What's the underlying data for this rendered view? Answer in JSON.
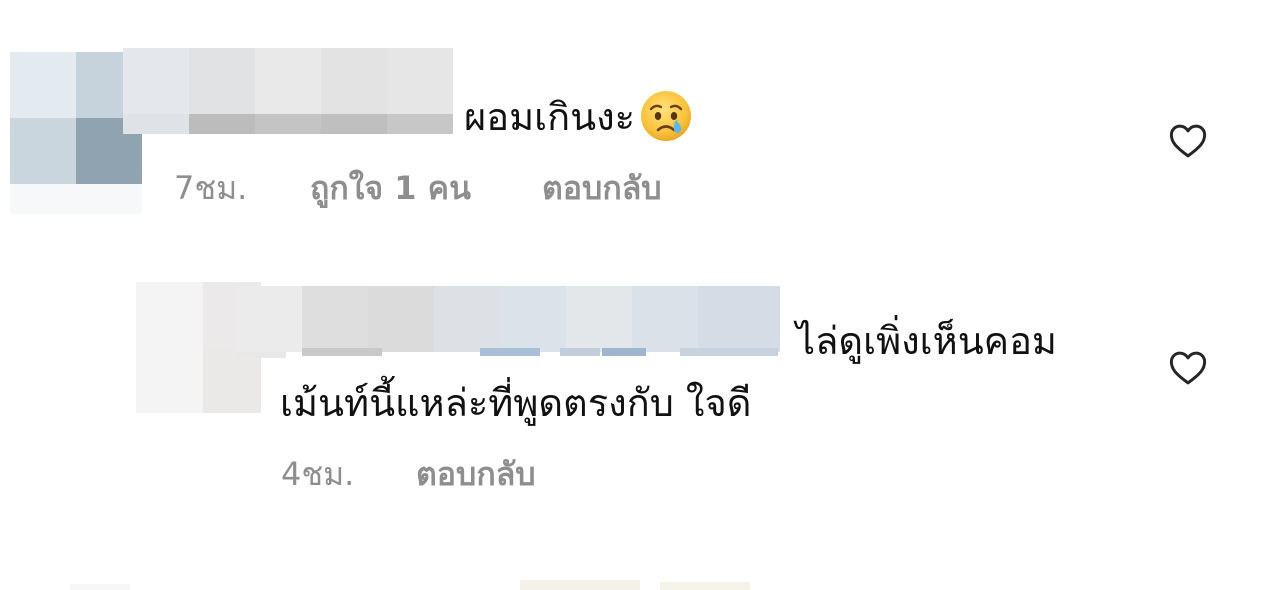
{
  "comments": [
    {
      "text": "ผอมเกินงะ",
      "emoji": "crying-face-icon",
      "time": "7ชม.",
      "likes": "ถูกใจ 1 คน",
      "reply": "ตอบกลับ"
    },
    {
      "text_line1": "ไล่ดูเพิ่งเห็นคอม",
      "text_line2": "เม้นท์นี้แหล่ะที่พูดตรงกับ ใจดี",
      "time": "4ชม.",
      "reply": "ตอบกลับ"
    }
  ],
  "colors": {
    "text": "#111111",
    "meta": "#8e8e8e",
    "heart": "#262626"
  }
}
